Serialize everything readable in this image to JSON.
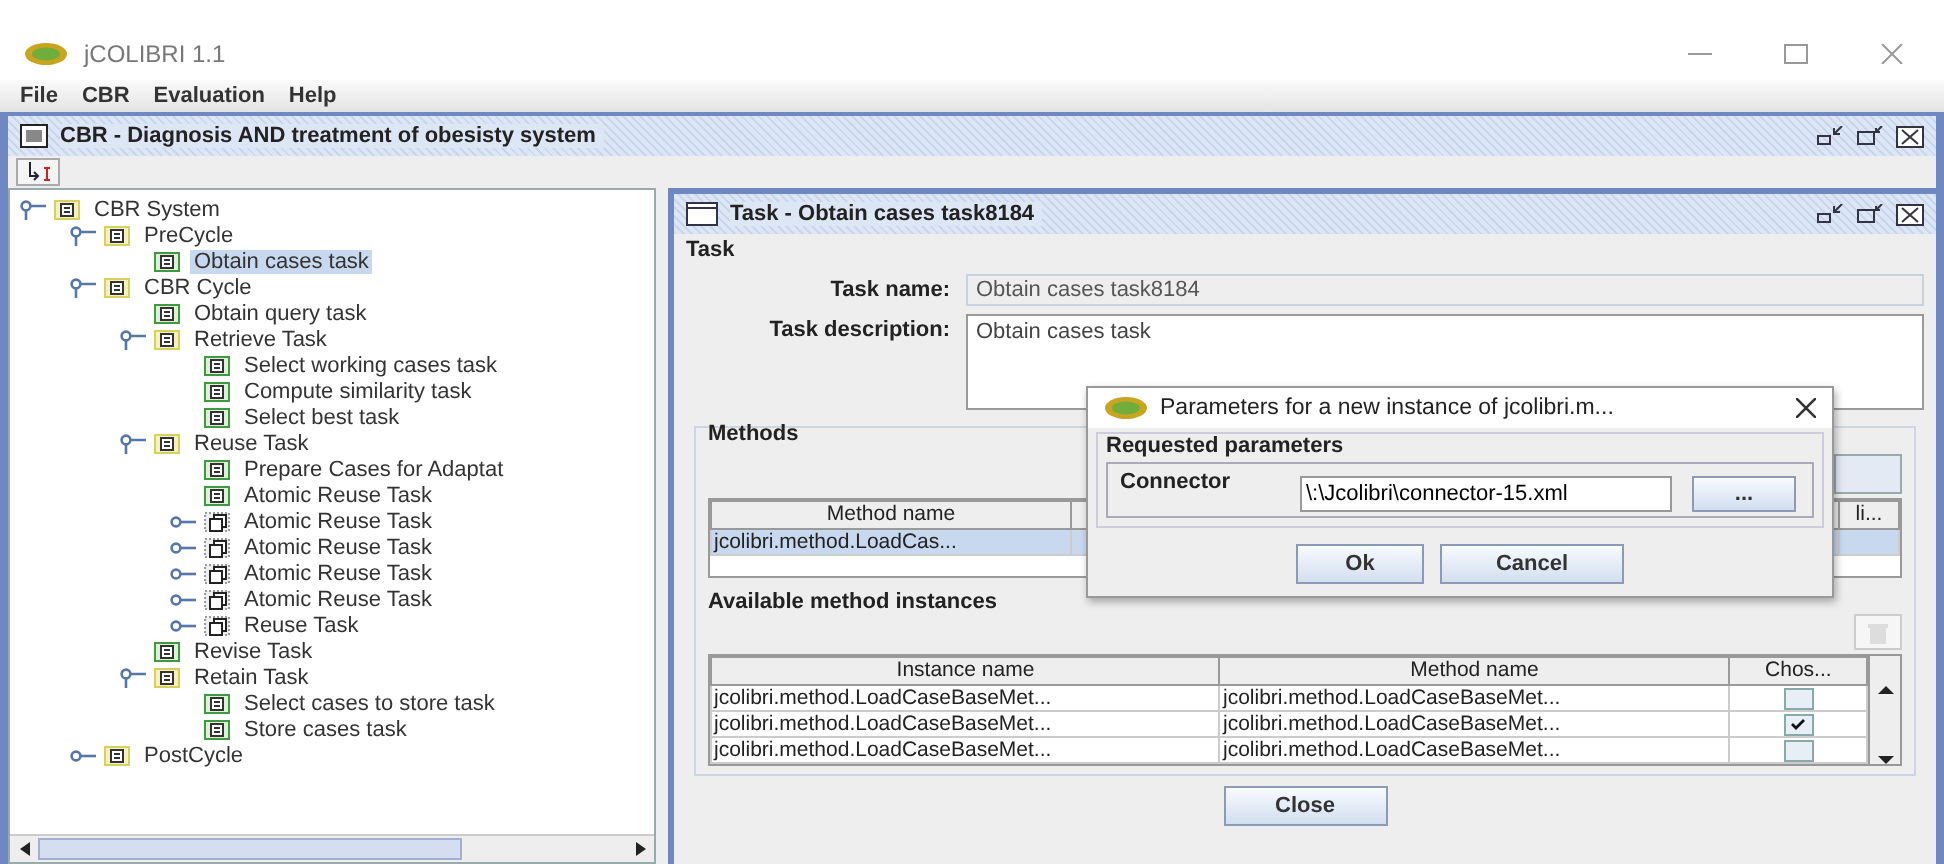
{
  "window": {
    "title": "jCOLIBRI 1.1"
  },
  "menu": [
    "File",
    "CBR",
    "Evaluation",
    "Help"
  ],
  "project_frame": {
    "title": "CBR - Diagnosis AND treatment of obesisty system"
  },
  "tree": [
    {
      "label": "CBR System",
      "kind": "composite",
      "expanded": true,
      "selected": false,
      "children": [
        {
          "label": "PreCycle",
          "kind": "composite",
          "expanded": true,
          "selected": false,
          "children": [
            {
              "label": "Obtain cases task",
              "kind": "task",
              "selected": true
            }
          ]
        },
        {
          "label": "CBR Cycle",
          "kind": "composite",
          "expanded": true,
          "selected": false,
          "children": [
            {
              "label": "Obtain query task",
              "kind": "task",
              "selected": false
            },
            {
              "label": "Retrieve Task",
              "kind": "composite",
              "expanded": true,
              "selected": false,
              "children": [
                {
                  "label": "Select working cases task",
                  "kind": "task",
                  "selected": false
                },
                {
                  "label": "Compute similarity task",
                  "kind": "task",
                  "selected": false
                },
                {
                  "label": "Select best task",
                  "kind": "task",
                  "selected": false
                }
              ]
            },
            {
              "label": "Reuse Task",
              "kind": "composite",
              "expanded": true,
              "selected": false,
              "children": [
                {
                  "label": "Prepare Cases for Adaptat",
                  "kind": "task",
                  "selected": false
                },
                {
                  "label": "Atomic Reuse Task",
                  "kind": "task",
                  "selected": false
                },
                {
                  "label": "Atomic Reuse Task",
                  "kind": "method",
                  "expanded": false,
                  "selected": false
                },
                {
                  "label": "Atomic Reuse Task",
                  "kind": "method",
                  "expanded": false,
                  "selected": false
                },
                {
                  "label": "Atomic Reuse Task",
                  "kind": "method",
                  "expanded": false,
                  "selected": false
                },
                {
                  "label": "Atomic Reuse Task",
                  "kind": "method",
                  "expanded": false,
                  "selected": false
                },
                {
                  "label": "Reuse Task",
                  "kind": "method",
                  "expanded": false,
                  "selected": false
                }
              ]
            },
            {
              "label": "Revise Task",
              "kind": "task",
              "selected": false
            },
            {
              "label": "Retain Task",
              "kind": "composite",
              "expanded": true,
              "selected": false,
              "children": [
                {
                  "label": "Select cases to store task",
                  "kind": "task",
                  "selected": false
                },
                {
                  "label": "Store cases task",
                  "kind": "task",
                  "selected": false
                }
              ]
            }
          ]
        },
        {
          "label": "PostCycle",
          "kind": "composite",
          "expanded": false,
          "selected": false
        }
      ]
    }
  ],
  "task_frame": {
    "title": "Task - Obtain cases task8184",
    "group": "Task",
    "name_label": "Task name:",
    "name_value": "Obtain cases task8184",
    "description_label": "Task description:",
    "description_value": "Obtain cases task",
    "methods_group": "Methods",
    "methods_table": {
      "columns": [
        "Method name",
        "li..."
      ],
      "rows": [
        {
          "cells": [
            "jcolibri.method.LoadCas..."
          ],
          "selected": true
        }
      ]
    },
    "instances_label": "Available method instances",
    "instances_table": {
      "columns": [
        "Instance name",
        "Method name",
        "Chos..."
      ],
      "rows": [
        {
          "instance": "jcolibri.method.LoadCaseBaseMet...",
          "method": "jcolibri.method.LoadCaseBaseMet...",
          "chosen": false
        },
        {
          "instance": "jcolibri.method.LoadCaseBaseMet...",
          "method": "jcolibri.method.LoadCaseBaseMet...",
          "chosen": true
        },
        {
          "instance": "jcolibri.method.LoadCaseBaseMet...",
          "method": "jcolibri.method.LoadCaseBaseMet...",
          "chosen": false
        }
      ]
    },
    "close_button": "Close"
  },
  "dialog": {
    "title": "Parameters for a new instance of jcolibri.m...",
    "group": "Requested parameters",
    "field_label": "Connector",
    "field_value": "\\:\\Jcolibri\\connector-15.xml",
    "browse_button": "...",
    "buttons": [
      "Ok",
      "Cancel"
    ]
  }
}
